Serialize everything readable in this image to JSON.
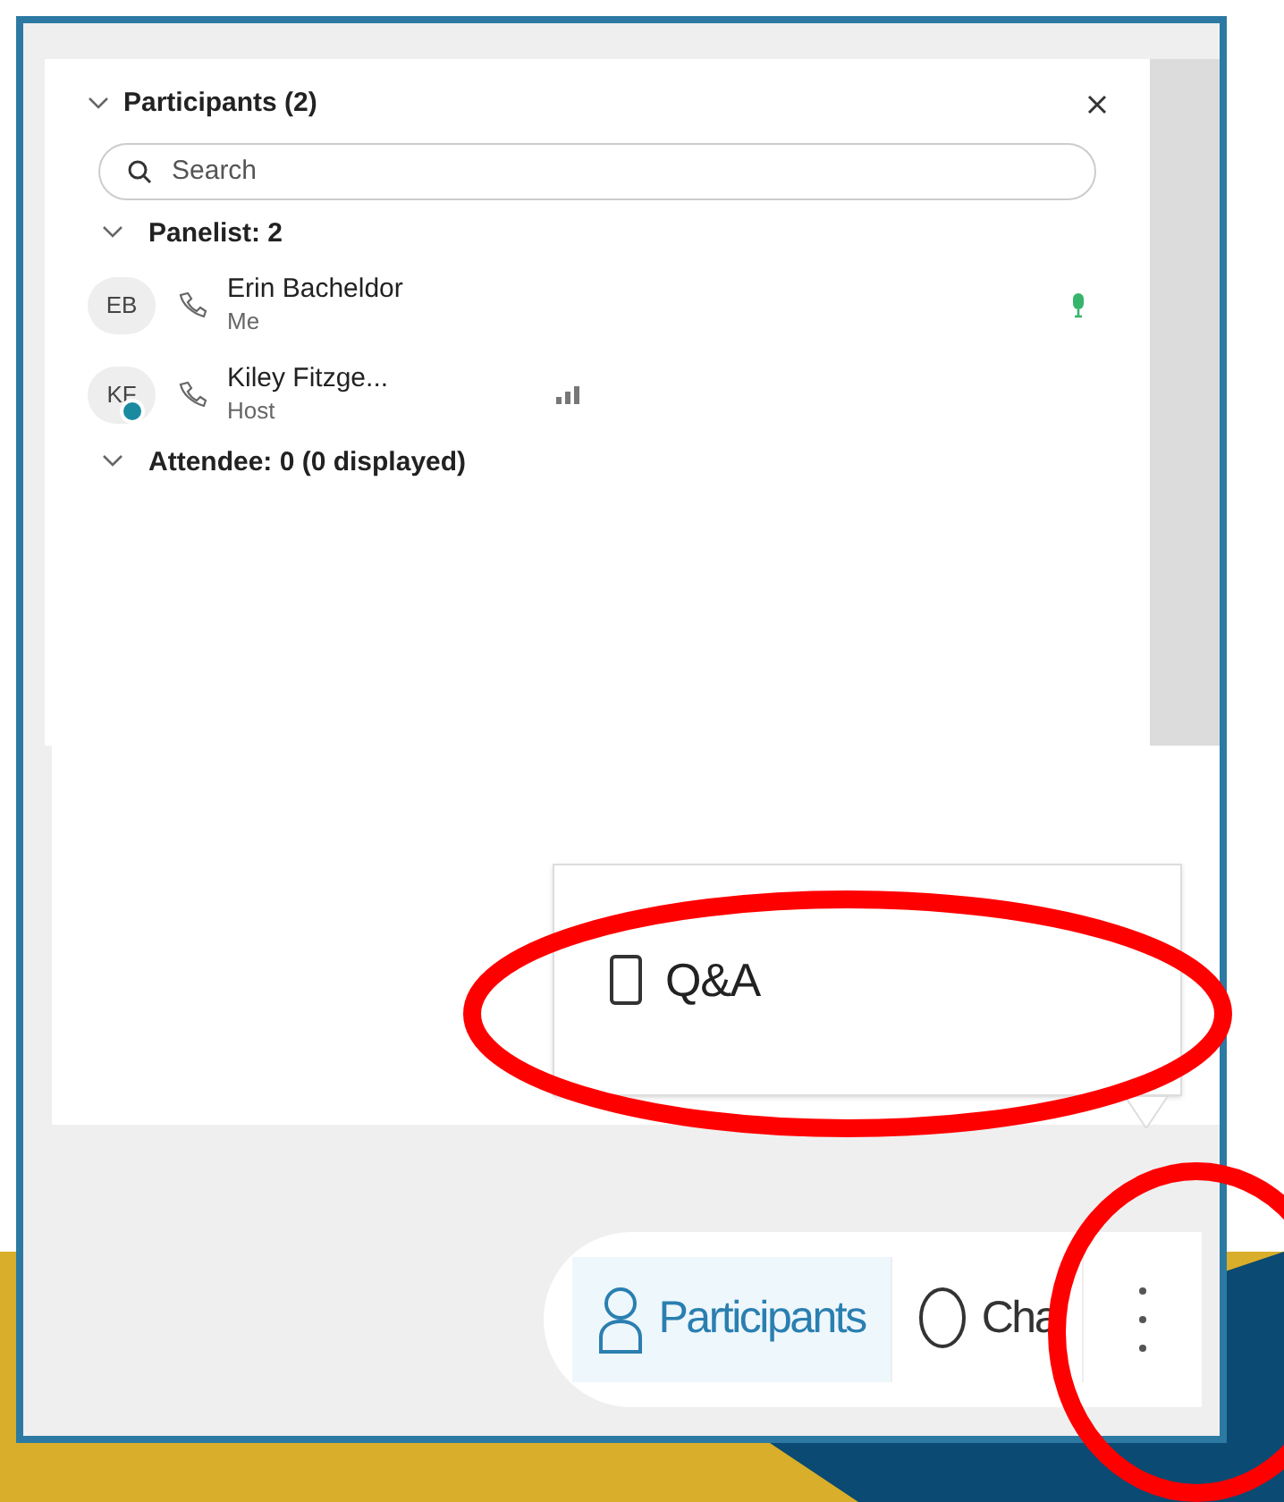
{
  "panel": {
    "title": "Participants (2)",
    "search": {
      "placeholder": "Search"
    },
    "groups": [
      {
        "label": "Panelist: 2",
        "expanded": true,
        "children": [
          {
            "initials": "EB",
            "name": "Erin Bacheldor",
            "role": "Me",
            "badge": false,
            "kind": "mic"
          },
          {
            "initials": "KF",
            "name": "Kiley Fitzge...",
            "role": "Host",
            "badge": true,
            "kind": "signal"
          }
        ]
      },
      {
        "label": "Attendee: 0 (0 displayed)",
        "expanded": true
      }
    ]
  },
  "menu": {
    "items": [
      {
        "label": "Q&A"
      }
    ]
  },
  "toolbar": {
    "tabs": [
      {
        "label": "Participants",
        "kind": "participants",
        "selected": true
      },
      {
        "label": "Cha",
        "kind": "chat",
        "selected": false
      },
      {
        "kind": "more",
        "selected": false
      }
    ]
  }
}
